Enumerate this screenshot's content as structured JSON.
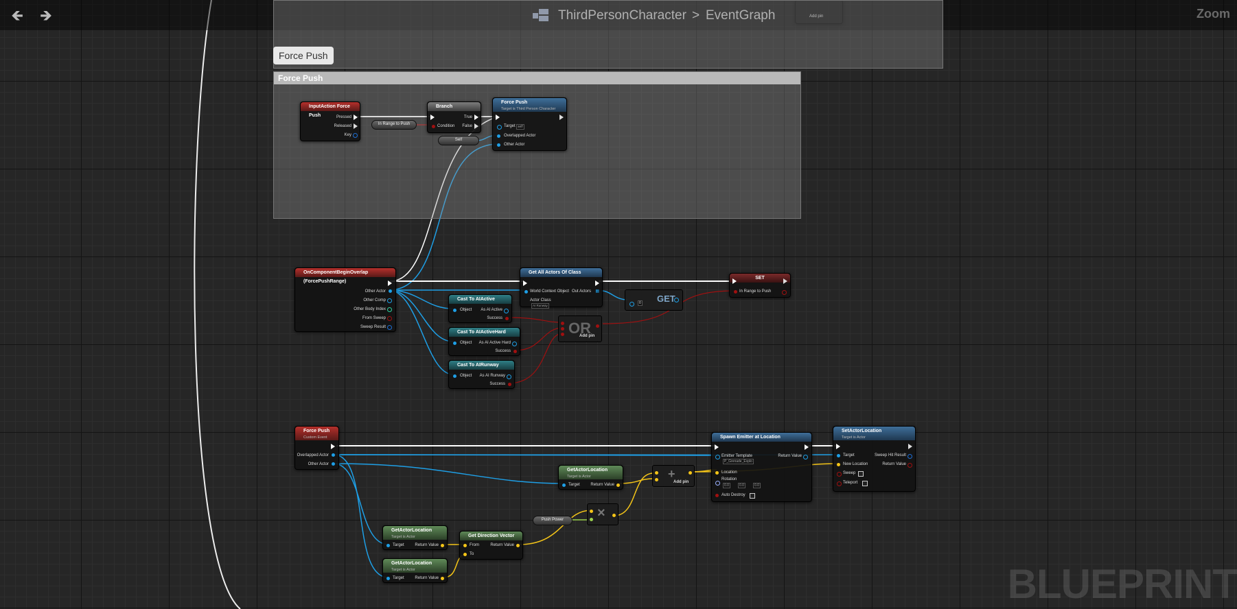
{
  "toolbar": {
    "back_icon": "arrow-left-icon",
    "forward_icon": "arrow-right-icon"
  },
  "breadcrumb": {
    "blueprint": "ThirdPersonCharacter",
    "separator": ">",
    "graph": "EventGraph"
  },
  "zoom_label": "Zoom",
  "watermark": "BLUEPRINT",
  "comment": {
    "bubble": "Force Push",
    "title": "Force Push"
  },
  "top_ghost": {
    "true_label": "True",
    "add_pin": "Add pin"
  },
  "input_action": {
    "title": "InputAction Force Push",
    "pressed": "Pressed",
    "released": "Released",
    "key": "Key"
  },
  "in_range_pill": "In Range to Push",
  "branch": {
    "title": "Branch",
    "condition": "Condition",
    "true": "True",
    "false": "False"
  },
  "self_pill": "Self",
  "force_push_call": {
    "title": "Force Push",
    "subtitle": "Target is Third Person Character",
    "target": "Target",
    "target_default": "self",
    "overlapped": "Overlapped Actor",
    "other": "Other Actor"
  },
  "overlap_event": {
    "title": "OnComponentBeginOverlap (ForcePushRange)",
    "other_actor": "Other Actor",
    "other_comp": "Other Comp",
    "other_body": "Other Body Index",
    "from_sweep": "From Sweep",
    "sweep_result": "Sweep Result"
  },
  "get_all_actors": {
    "title": "Get All Actors Of Class",
    "world": "World Context Object",
    "out_actors": "Out Actors",
    "actor_class": "Actor Class",
    "actor_class_value": "AI Runway"
  },
  "get_node": {
    "label": "GET",
    "index": "0"
  },
  "set_node": {
    "title": "SET",
    "var": "In Range to Push"
  },
  "casts": [
    {
      "title": "Cast To AIActive",
      "object": "Object",
      "as_label": "As AI Active",
      "success": "Success"
    },
    {
      "title": "Cast To AIActiveHard",
      "object": "Object",
      "as_label": "As AI Active Hard",
      "success": "Success"
    },
    {
      "title": "Cast To AIRunway",
      "object": "Object",
      "as_label": "As AI Runway",
      "success": "Success"
    }
  ],
  "or_node": {
    "label": "OR",
    "add_pin": "Add pin"
  },
  "custom_event": {
    "title": "Force Push",
    "subtitle": "Custom Event",
    "overlapped": "Overlapped Actor",
    "other": "Other Actor"
  },
  "get_actor_location": {
    "title": "GetActorLocation",
    "subtitle": "Target is Actor",
    "target": "Target",
    "return_value": "Return Value"
  },
  "add_node": {
    "label": "+",
    "add_pin": "Add pin"
  },
  "spawn_emitter": {
    "title": "Spawn Emitter at Location",
    "emitter": "Emitter Template",
    "emitter_value": "P_Grenade_Explo",
    "return_value": "Return Value",
    "location": "Location",
    "rotation": "Rotation",
    "rot_values": [
      "0.0",
      "0.0",
      "0.0"
    ],
    "auto_destroy": "Auto Destroy"
  },
  "set_actor_location": {
    "title": "SetActorLocation",
    "subtitle": "Target is Actor",
    "target": "Target",
    "sweep_hit": "Sweep Hit Result",
    "new_location": "New Location",
    "return_value": "Return Value",
    "sweep": "Sweep",
    "teleport": "Teleport"
  },
  "push_power_pill": "Push Power",
  "multiply_node": {
    "label": "×"
  },
  "get_direction": {
    "title": "Get Direction Vector",
    "from": "From",
    "to": "To",
    "return_value": "Return Value"
  },
  "colors": {
    "exec": "#ffffff",
    "object": "#1e9fe6",
    "bool": "#9b1010",
    "vector": "#f5c518",
    "float": "#9bd34d",
    "struct": "#1e6fd6"
  }
}
